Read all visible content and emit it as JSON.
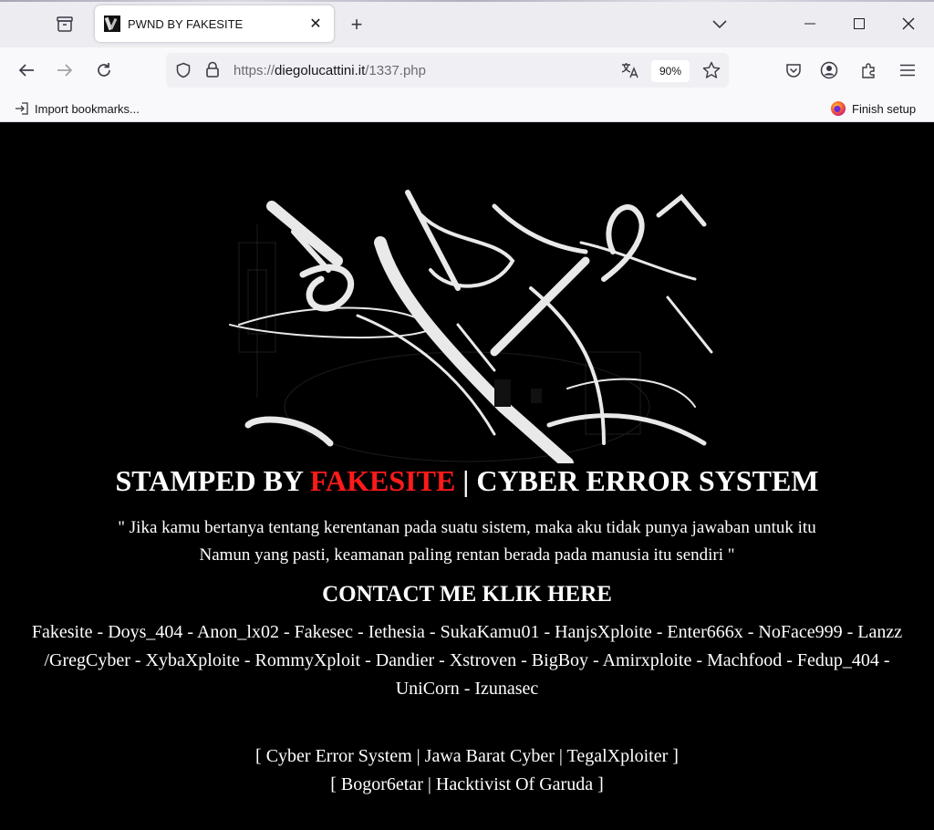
{
  "browser": {
    "tab_title": "PWND BY FAKESITE",
    "tab_close": "✕",
    "new_tab": "+",
    "url_scheme": "https://",
    "url_host": "diegolucattini.it",
    "url_path": "/1337.php",
    "zoom": "90%",
    "bookmarks": {
      "import_label": "Import bookmarks...",
      "finish_setup_label": "Finish setup"
    }
  },
  "page": {
    "headline_part1": "STAMPED BY ",
    "headline_red": "FAKESITE",
    "headline_part2": " | CYBER ERROR SYSTEM",
    "accent_color": "#ff1a1a",
    "quote_line1": "\" Jika kamu bertanya tentang kerentanan pada suatu sistem, maka aku tidak punya jawaban untuk itu",
    "quote_line2": "Namun yang pasti, keamanan paling rentan berada pada manusia itu sendiri \"",
    "contact": "CONTACT ME KLIK HERE",
    "members_line1": "Fakesite - Doys_404 - Anon_lx02 - Fakesec - Iethesia - SukaKamu01 - HanjsXploite - Enter666x - NoFace999 - Lanzz",
    "members_line2": "/GregCyber - XybaXploite - RommyXploit - Dandier - Xstroven - BigBoy - Amirxploite - Machfood - Fedup_404 - UniCorn - Izunasec",
    "groups_line1": "[ Cyber Error System | Jawa Barat Cyber | TegalXploiter ]",
    "groups_line2": "[ Bogor6etar | Hacktivist Of Garuda ]"
  }
}
